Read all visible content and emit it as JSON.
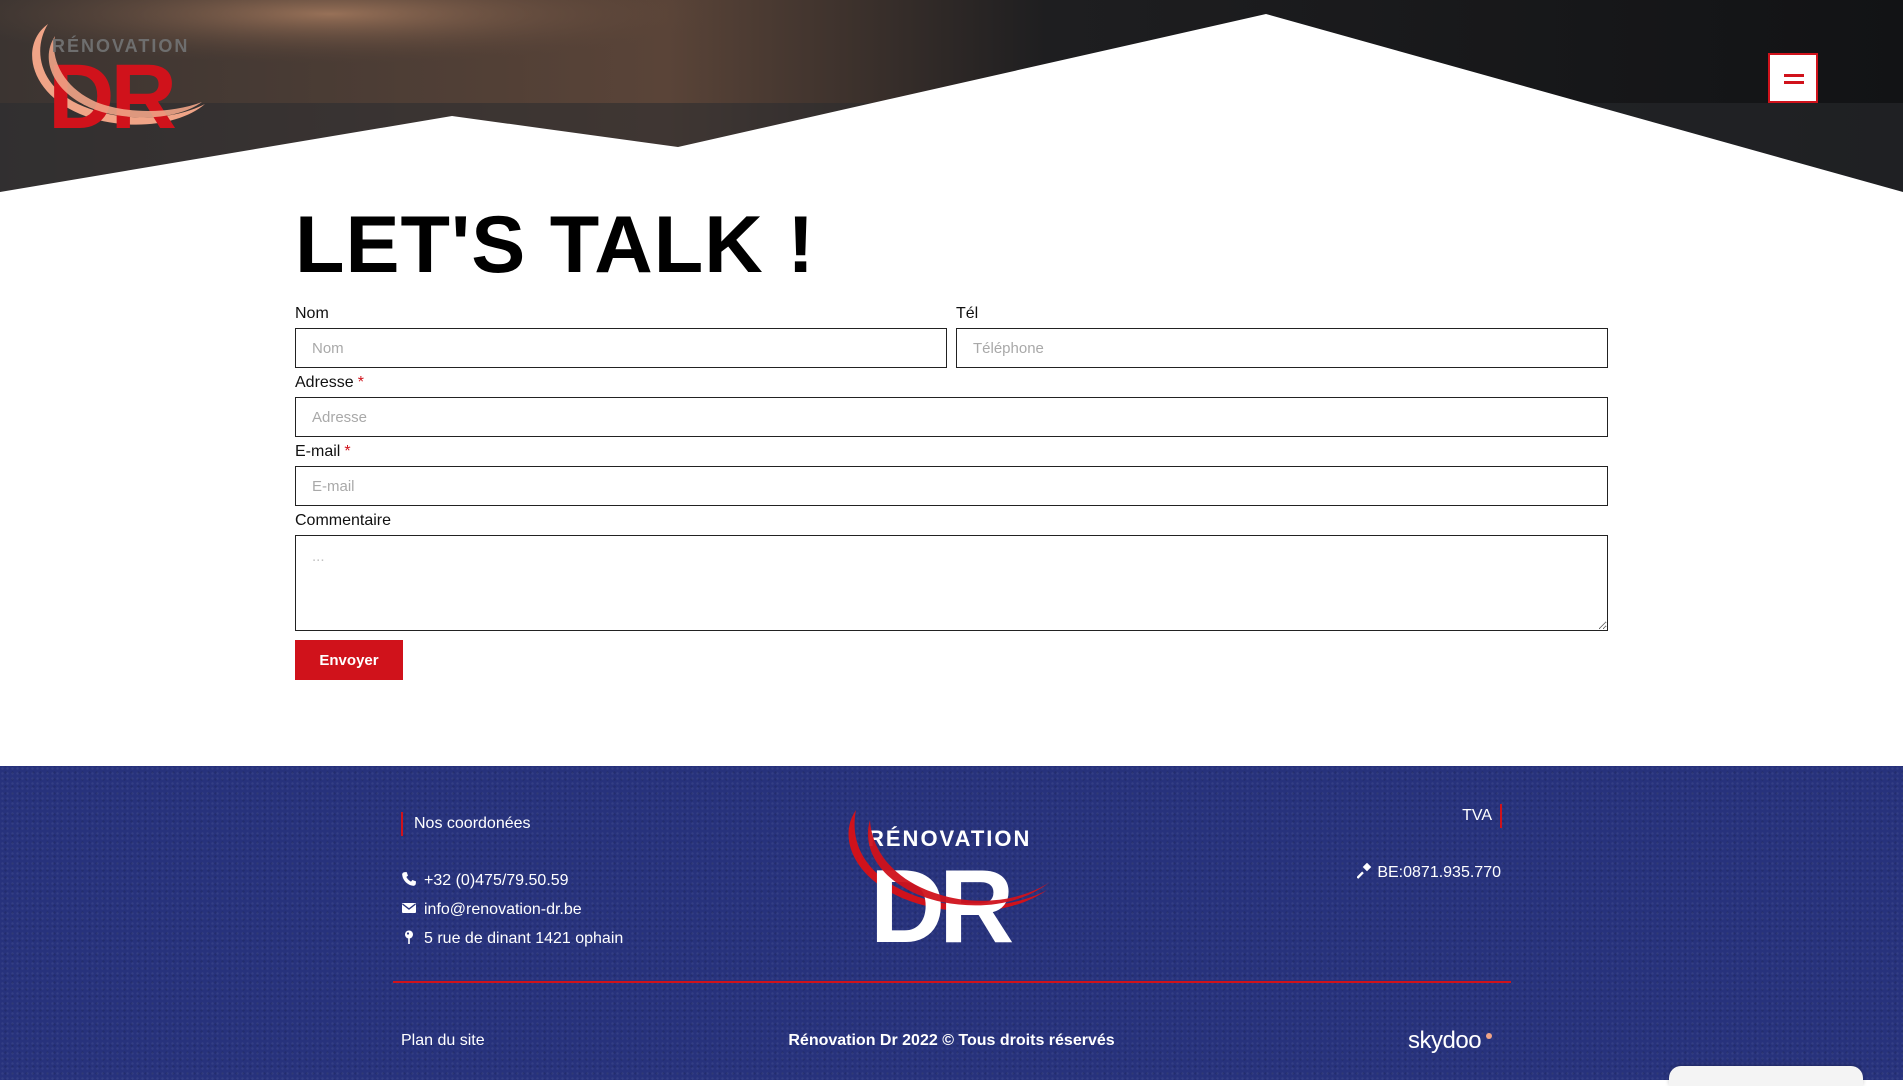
{
  "header": {
    "logo_top_text": "RÉNOVATION",
    "logo_big_text": "DR",
    "menu_icon": "hamburger-menu-icon"
  },
  "contact_form": {
    "title": "LET'S TALK !",
    "fields": {
      "nom": {
        "label": "Nom",
        "placeholder": "Nom",
        "value": ""
      },
      "tel": {
        "label": "Tél",
        "placeholder": "Téléphone",
        "value": ""
      },
      "adresse": {
        "label": "Adresse",
        "required_mark": "*",
        "placeholder": "Adresse",
        "value": ""
      },
      "email": {
        "label": "E-mail",
        "required_mark": "*",
        "placeholder": "E-mail",
        "value": ""
      },
      "commentaire": {
        "label": "Commentaire",
        "placeholder": "...",
        "value": ""
      }
    },
    "submit_label": "Envoyer"
  },
  "footer": {
    "contact_heading": "Nos coordonées",
    "phone": "+32 (0)475/79.50.59",
    "email": "info@renovation-dr.be",
    "address": "5 rue de dinant 1421 ophain",
    "logo_top_text": "RÉNOVATION",
    "logo_big_text": "DR",
    "tva_heading": "TVA",
    "tva_number": "BE:0871.935.770",
    "sitemap_link": "Plan du site",
    "copyright": "Rénovation Dr 2022 © Tous droits réservés",
    "agency_name": "skydoo",
    "icons": [
      "phone-icon",
      "envelope-icon",
      "map-pin-icon",
      "gavel-icon"
    ]
  },
  "colors": {
    "accent_red": "#d0121b",
    "footer_blue": "#27327c",
    "logo_salmon": "#f0a487",
    "text_dark": "#111111"
  }
}
